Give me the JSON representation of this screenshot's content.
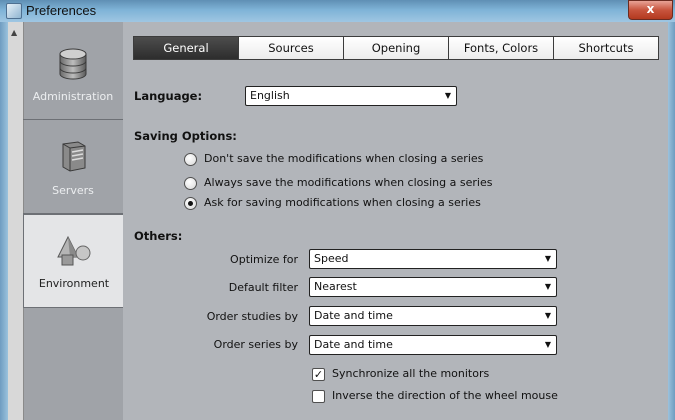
{
  "window": {
    "title": "Preferences",
    "close_glyph": "x"
  },
  "sidebar": {
    "items": [
      {
        "label": "Administration",
        "icon": "database-icon",
        "active": false
      },
      {
        "label": "Servers",
        "icon": "server-icon",
        "active": false
      },
      {
        "label": "Environment",
        "icon": "shapes-icon",
        "active": true
      }
    ]
  },
  "tabs": [
    {
      "label": "General",
      "active": true
    },
    {
      "label": "Sources",
      "active": false
    },
    {
      "label": "Opening",
      "active": false
    },
    {
      "label": "Fonts, Colors",
      "active": false
    },
    {
      "label": "Shortcuts",
      "active": false
    }
  ],
  "general": {
    "language": {
      "label": "Language:",
      "value": "English"
    },
    "saving": {
      "label": "Saving Options:",
      "options": [
        {
          "label": "Don't save the modifications when closing a series",
          "selected": false
        },
        {
          "label": "Always save the modifications when closing a series",
          "selected": false
        },
        {
          "label": "Ask for saving modifications when closing a series",
          "selected": true
        }
      ]
    },
    "others": {
      "label": "Others:",
      "fields": [
        {
          "label": "Optimize for",
          "value": "Speed"
        },
        {
          "label": "Default filter",
          "value": "Nearest"
        },
        {
          "label": "Order studies by",
          "value": "Date and time"
        },
        {
          "label": "Order series by",
          "value": "Date and time"
        }
      ],
      "checkboxes": [
        {
          "label": "Synchronize all the monitors",
          "checked": true
        },
        {
          "label": "Inverse the direction of the wheel mouse",
          "checked": false
        }
      ]
    }
  },
  "colors": {
    "active_tab": "#3a3a3a",
    "panel": "#b2b5ba",
    "sidebar": "#a0a3a8",
    "close_button": "#c8553e"
  }
}
